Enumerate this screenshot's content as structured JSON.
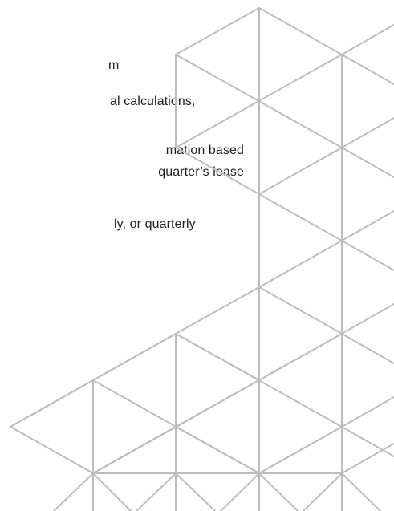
{
  "document": {
    "lines": [
      "m",
      "al calculations,",
      "mation  based",
      "quarter’s lease",
      "ly, or quarterly"
    ]
  },
  "decoration": {
    "pattern_icon": "triangular-line-pattern-icon",
    "line_color": "#bdbdbd"
  }
}
